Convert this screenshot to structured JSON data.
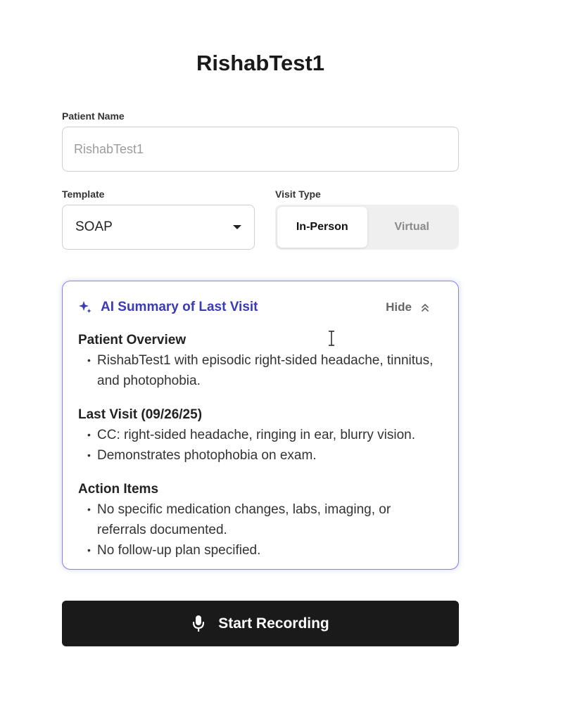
{
  "header": {
    "title": "RishabTest1"
  },
  "patient_name": {
    "label": "Patient Name",
    "placeholder": "RishabTest1",
    "value": ""
  },
  "template": {
    "label": "Template",
    "selected": "SOAP",
    "icon": "caret-down-icon"
  },
  "visit_type": {
    "label": "Visit Type",
    "options": [
      "In-Person",
      "Virtual"
    ],
    "selected": "In-Person"
  },
  "summary": {
    "icon": "sparkle-icon",
    "title": "AI Summary of Last Visit",
    "hide_label": "Hide",
    "hide_icon": "chevrons-up-icon",
    "accent_color": "#3b3bb3",
    "border_color": "#8b7cf0",
    "sections": [
      {
        "title": "Patient Overview",
        "bullets": [
          "RishabTest1 with episodic right-sided headache, tinnitus, and photophobia."
        ]
      },
      {
        "title": "Last Visit (09/26/25)",
        "bullets": [
          "CC: right-sided headache, ringing in ear, blurry vision.",
          "Demonstrates photophobia on exam."
        ]
      },
      {
        "title": "Action Items",
        "bullets": [
          "No specific medication changes, labs, imaging, or referrals documented.",
          "No follow-up plan specified."
        ]
      }
    ]
  },
  "record": {
    "label": "Start Recording",
    "icon": "microphone-icon",
    "background": "#1a1a1a"
  }
}
